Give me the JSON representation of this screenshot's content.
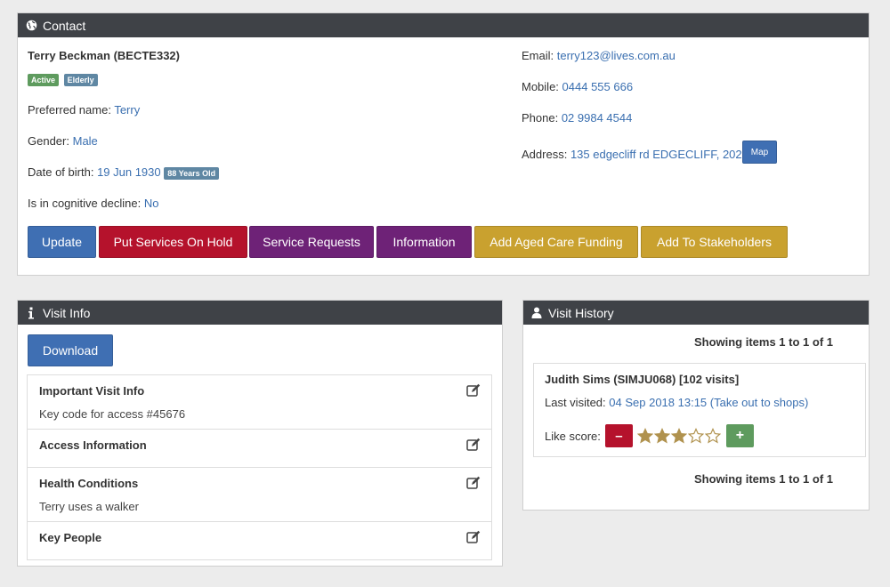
{
  "contact": {
    "header": "Contact",
    "name": "Terry Beckman (BECTE332)",
    "badges": [
      "Active",
      "Elderly"
    ],
    "preferred_label": "Preferred name:",
    "preferred_value": "Terry",
    "gender_label": "Gender:",
    "gender_value": "Male",
    "dob_label": "Date of birth:",
    "dob_value": "19 Jun 1930",
    "age_badge": "88 Years Old",
    "cognitive_label": "Is in cognitive decline:",
    "cognitive_value": "No",
    "email_label": "Email:",
    "email_value": "terry123@lives.com.au",
    "mobile_label": "Mobile:",
    "mobile_value": "0444 555 666",
    "phone_label": "Phone:",
    "phone_value": "02 9984 4544",
    "address_label": "Address:",
    "address_value": "135 edgecliff rd EDGECLIFF, 2027",
    "map_button": "Map",
    "buttons": {
      "update": "Update",
      "hold": "Put Services On Hold",
      "requests": "Service Requests",
      "information": "Information",
      "funding": "Add Aged Care Funding",
      "stakeholders": "Add To Stakeholders"
    }
  },
  "visit_info": {
    "header": "Visit Info",
    "download": "Download",
    "items": [
      {
        "title": "Important Visit Info",
        "detail": "Key code for access #45676"
      },
      {
        "title": "Access Information",
        "detail": ""
      },
      {
        "title": "Health Conditions",
        "detail": "Terry uses a walker"
      },
      {
        "title": "Key People",
        "detail": ""
      }
    ]
  },
  "visit_history": {
    "header": "Visit History",
    "showing_top": "Showing items 1 to 1 of 1",
    "showing_bottom": "Showing items 1 to 1 of 1",
    "visitor": "Judith Sims (SIMJU068) [102 visits]",
    "last_label": "Last visited:",
    "last_value": "04 Sep 2018 13:15 (Take out to shops)",
    "like_label": "Like score:",
    "like_score": 3,
    "like_max": 5,
    "minus": "–",
    "plus": "+"
  },
  "colors": {
    "header": "#3f4247",
    "update": "#3f6fb3",
    "hold": "#b5122c",
    "purple": "#6e2277",
    "gold": "#c9a12f",
    "active": "#5e9b5e",
    "elderly": "#5f87a3",
    "star": "#b0924e"
  }
}
